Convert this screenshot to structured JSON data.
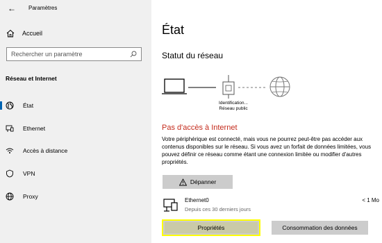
{
  "window": {
    "title": "Paramètres"
  },
  "sidebar": {
    "home_label": "Accueil",
    "search_placeholder": "Rechercher un paramètre",
    "section_title": "Réseau et Internet",
    "items": [
      {
        "label": "État",
        "icon": "globe-icon",
        "selected": true
      },
      {
        "label": "Ethernet",
        "icon": "ethernet-icon",
        "selected": false
      },
      {
        "label": "Accès à distance",
        "icon": "dialup-icon",
        "selected": false
      },
      {
        "label": "VPN",
        "icon": "vpn-icon",
        "selected": false
      },
      {
        "label": "Proxy",
        "icon": "proxy-globe-icon",
        "selected": false
      }
    ]
  },
  "main": {
    "title": "État",
    "subtitle": "Statut du réseau",
    "diagram_label_1": "Identification...",
    "diagram_label_2": "Réseau public",
    "error_title": "Pas d'accès à Internet",
    "description": "Votre périphérique est connecté, mais vous ne pourrez peut-être pas accéder aux contenus disponibles sur le réseau. Si vous avez un forfait de données limitées, vous pouvez définir ce réseau comme étant une connexion limitée ou modifier d'autres propriétés.",
    "troubleshoot_label": "Dépanner",
    "connection": {
      "name": "Ethernet0",
      "subtitle": "Depuis ces 30 derniers jours",
      "usage": "< 1 Mo"
    },
    "properties_label": "Propriétés",
    "data_usage_label": "Consommation des données"
  }
}
